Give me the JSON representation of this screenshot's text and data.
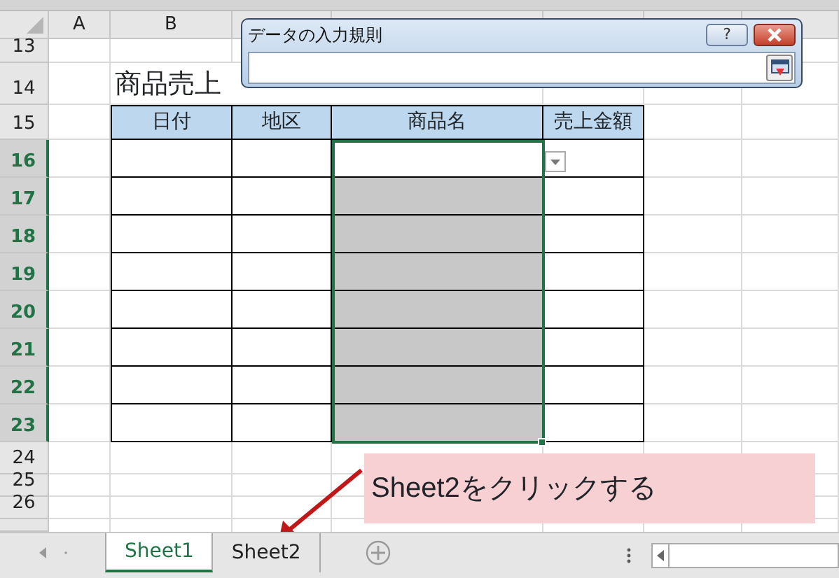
{
  "columns": [
    {
      "label": "A",
      "selected": false
    },
    {
      "label": "B",
      "selected": false
    }
  ],
  "rows": [
    {
      "label": "13",
      "selected": false
    },
    {
      "label": "14",
      "selected": false
    },
    {
      "label": "15",
      "selected": false
    },
    {
      "label": "16",
      "selected": true
    },
    {
      "label": "17",
      "selected": true
    },
    {
      "label": "18",
      "selected": true
    },
    {
      "label": "19",
      "selected": true
    },
    {
      "label": "20",
      "selected": true
    },
    {
      "label": "21",
      "selected": true
    },
    {
      "label": "22",
      "selected": true
    },
    {
      "label": "23",
      "selected": true
    },
    {
      "label": "24",
      "selected": false
    },
    {
      "label": "25",
      "selected": false
    },
    {
      "label": "26",
      "selected": false
    }
  ],
  "sheet_title": "商品売上",
  "table": {
    "columns": [
      "日付",
      "地区",
      "商品名",
      "売上金額"
    ],
    "rows": [
      {
        "shaded": false,
        "dropdown": true
      },
      {
        "shaded": true,
        "dropdown": false
      },
      {
        "shaded": true,
        "dropdown": false
      },
      {
        "shaded": true,
        "dropdown": false
      },
      {
        "shaded": true,
        "dropdown": false
      },
      {
        "shaded": true,
        "dropdown": false
      },
      {
        "shaded": true,
        "dropdown": false
      },
      {
        "shaded": true,
        "dropdown": false
      }
    ]
  },
  "dialog": {
    "title": "データの入力規則",
    "help_label": "?"
  },
  "callout": "Sheet2をクリックする",
  "sheet_tabs": [
    {
      "label": "Sheet1",
      "selected": true
    },
    {
      "label": "Sheet2",
      "selected": false
    }
  ]
}
